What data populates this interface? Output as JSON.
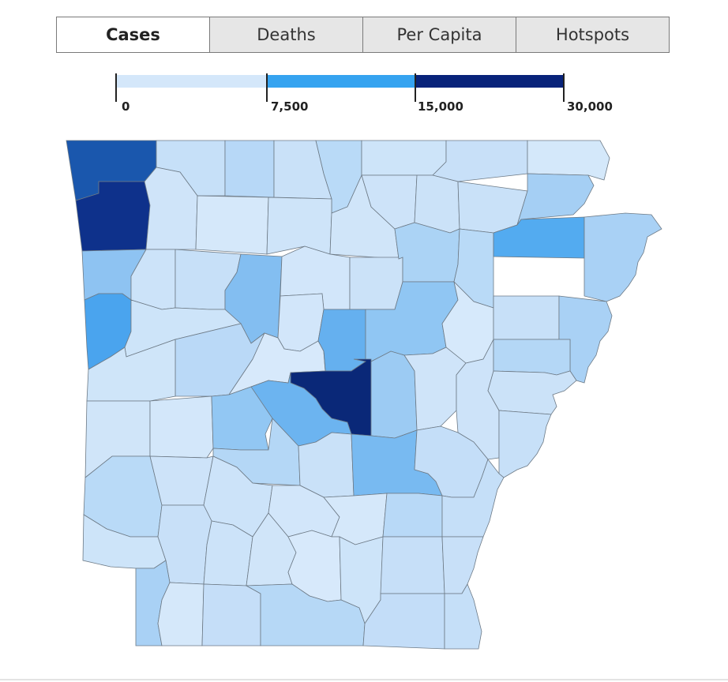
{
  "tabs": [
    {
      "label": "Cases",
      "active": true
    },
    {
      "label": "Deaths",
      "active": false
    },
    {
      "label": "Per Capita",
      "active": false
    },
    {
      "label": "Hotspots",
      "active": false
    }
  ],
  "legend": {
    "thresholds": [
      "0",
      "7,500",
      "15,000",
      "30,000"
    ],
    "colors": [
      "#d4e7fa",
      "#35a3f0",
      "#08237a"
    ]
  },
  "map": {
    "border_color": "#6d7a86",
    "outline_color": "#8a96a3"
  }
}
